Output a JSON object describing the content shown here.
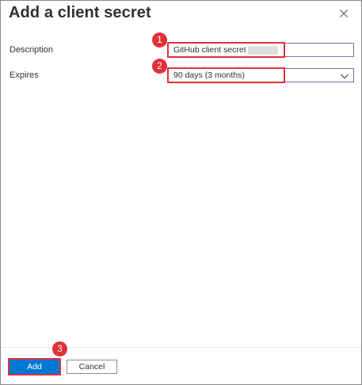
{
  "panel": {
    "title": "Add a client secret"
  },
  "form": {
    "description": {
      "label": "Description",
      "value": "GitHub client secret"
    },
    "expires": {
      "label": "Expires",
      "selected": "90 days (3 months)"
    }
  },
  "footer": {
    "add_label": "Add",
    "cancel_label": "Cancel"
  },
  "markers": [
    "1",
    "2",
    "3"
  ],
  "icons": {
    "close": "close-icon",
    "dropdown": "chevron-down-icon"
  },
  "colors": {
    "accent": "#0078d4",
    "focus_border": "#8764b8",
    "annotation": "#e0313a"
  }
}
